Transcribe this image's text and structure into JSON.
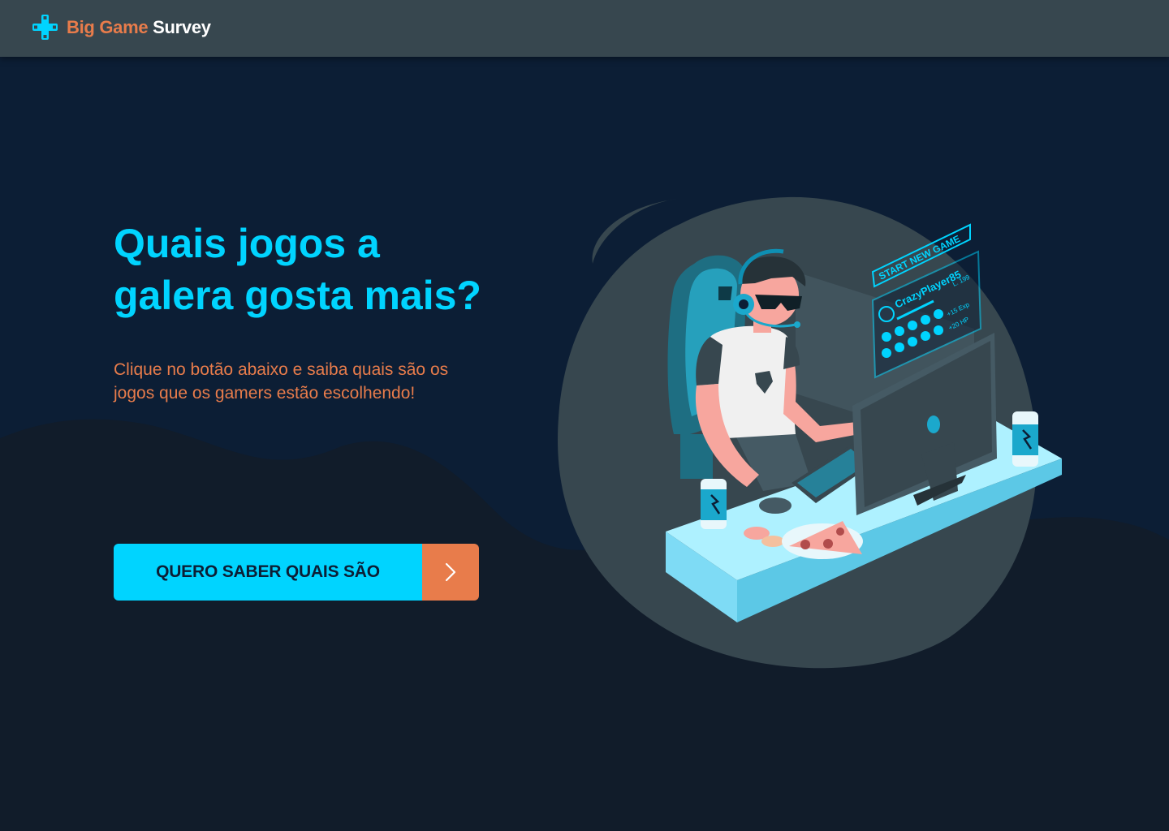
{
  "header": {
    "brand_part1": "Big Game",
    "brand_part2": "Survey"
  },
  "hero": {
    "title_line1": "Quais jogos a",
    "title_line2": "galera gosta mais?",
    "subtitle_line1": "Clique no botão abaixo e saiba quais são os",
    "subtitle_line2": "jogos que os gamers estão escolhendo!",
    "cta_label": "QUERO SABER QUAIS SÃO"
  },
  "illustration": {
    "screen_start_label": "START NEW GAME",
    "screen_player_name": "CrazyPlayer85",
    "screen_level": "L. 199",
    "screen_exp": "+15 Exp",
    "screen_hp": "+20 HP"
  },
  "icons": {
    "logo": "gamepad-cross-icon",
    "cta_arrow": "chevron-right-icon"
  },
  "colors": {
    "background": "#0c1e35",
    "wave": "#111c2a",
    "header": "#37474f",
    "accent_cyan": "#00d4ff",
    "accent_orange": "#e87c4b",
    "text_white": "#ffffff"
  }
}
